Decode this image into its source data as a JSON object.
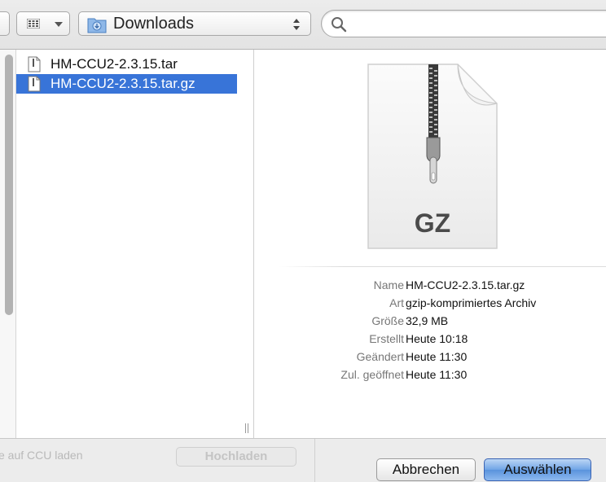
{
  "toolbar": {
    "view_menu_icon": "column-view-icon",
    "location": "Downloads",
    "location_icon": "downloads-folder-icon",
    "search": {
      "value": "",
      "placeholder": ""
    }
  },
  "files": [
    {
      "name": "HM-CCU2-2.3.15.tar",
      "selected": false,
      "icon": "document-icon"
    },
    {
      "name": "HM-CCU2-2.3.15.tar.gz",
      "selected": true,
      "icon": "document-icon"
    }
  ],
  "preview": {
    "badge": "GZ",
    "info": [
      {
        "key": "Name",
        "value": "HM-CCU2-2.3.15.tar.gz"
      },
      {
        "key": "Art",
        "value": "gzip-komprimiertes Archiv"
      },
      {
        "key": "Größe",
        "value": "32,9 MB"
      },
      {
        "key": "Erstellt",
        "value": "Heute 10:18"
      },
      {
        "key": "Geändert",
        "value": "Heute 11:30"
      },
      {
        "key": "Zul. geöffnet",
        "value": "Heute 11:30"
      }
    ]
  },
  "bottom": {
    "disabled_text": "e auf CCU laden",
    "upload_label": "Hochladen",
    "cancel_label": "Abbrechen",
    "choose_label": "Auswählen"
  },
  "colors": {
    "selection": "#3874d8",
    "accent_button": "#5a93dc"
  }
}
